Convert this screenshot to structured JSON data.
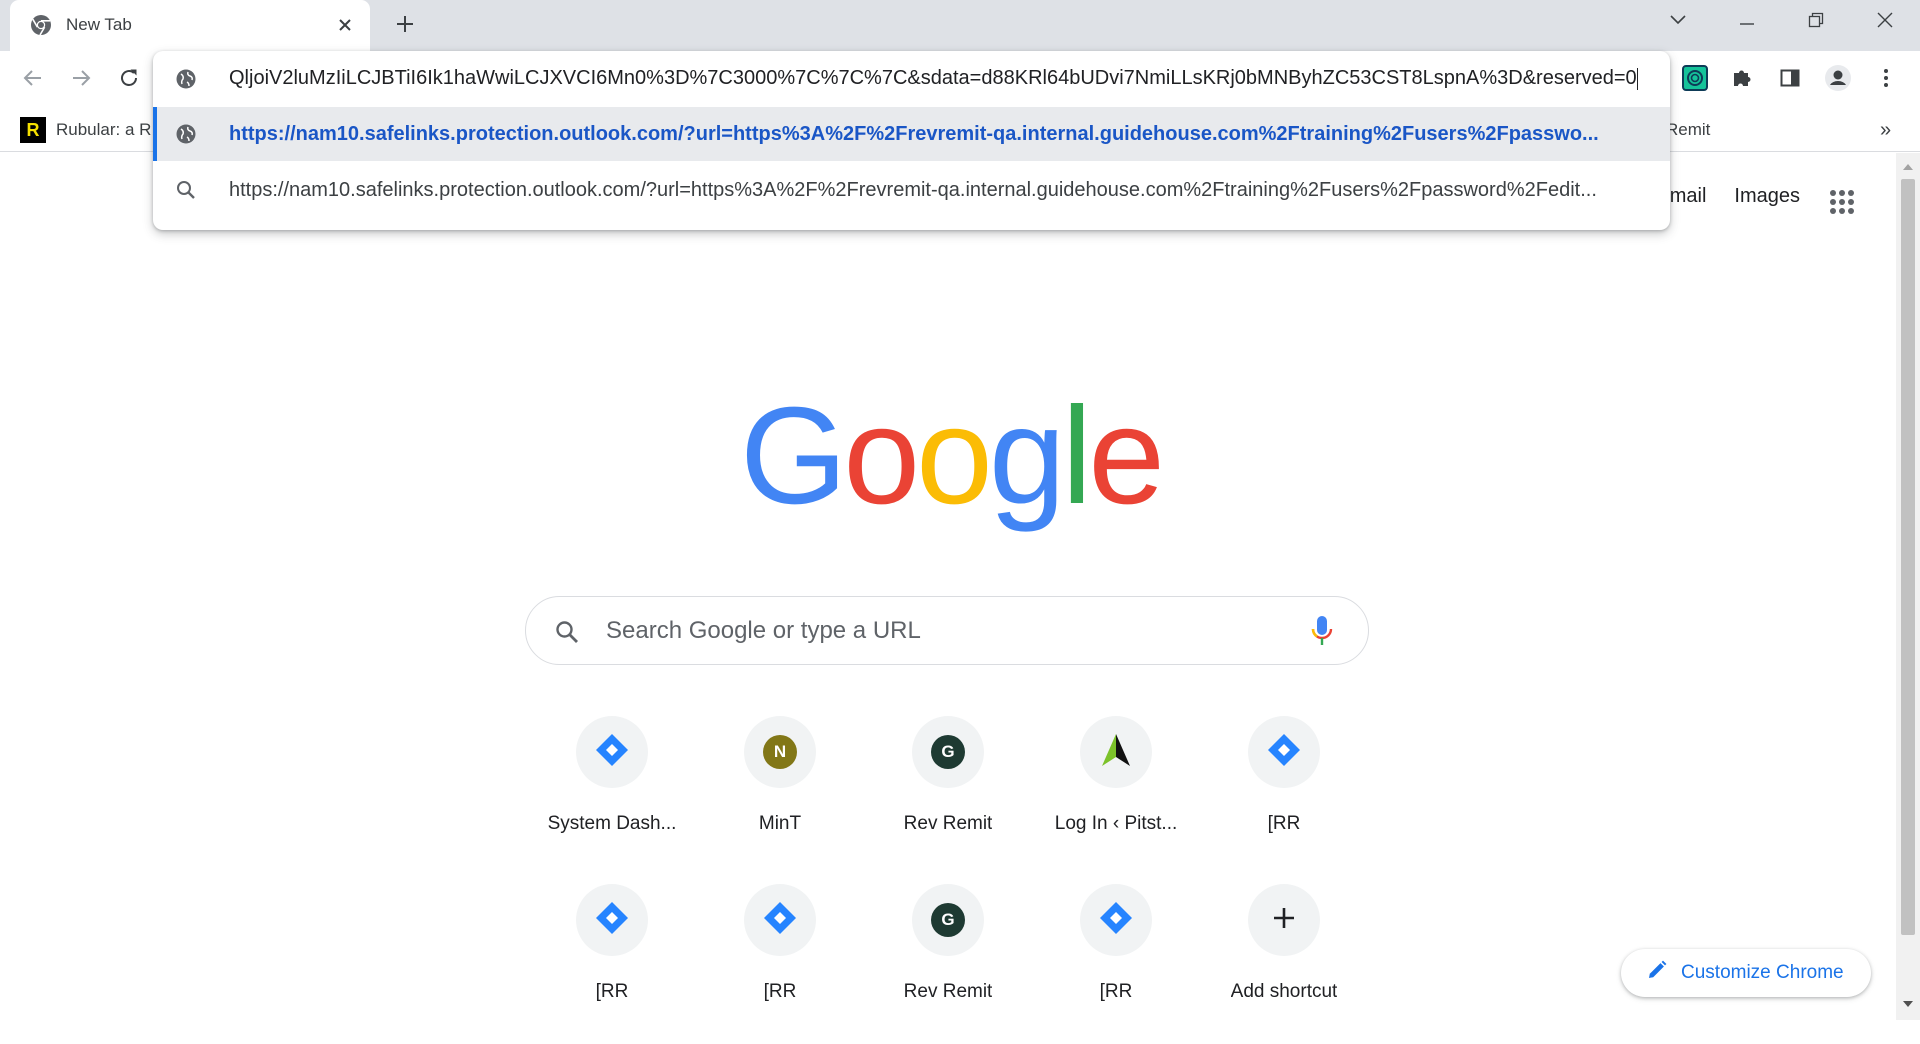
{
  "tab": {
    "title": "New Tab",
    "favicon": "chrome-icon",
    "close_icon": "close-icon"
  },
  "new_tab_icon": "plus-icon",
  "window_controls": [
    "chevron-down-icon",
    "minimize-icon",
    "restore-icon",
    "close-icon"
  ],
  "toolbar": {
    "back_icon": "arrow-left-icon",
    "forward_icon": "arrow-right-icon",
    "reload_icon": "reload-icon",
    "extensions": [
      "grammarly-icon",
      "puzzle-icon",
      "side-panel-icon",
      "profile-icon",
      "kebab-menu-icon"
    ]
  },
  "bookmarks": {
    "items": [
      {
        "label": "Rubular: a R",
        "icon": "rubular-icon"
      },
      {
        "label": "Remit"
      }
    ],
    "overflow": "»"
  },
  "omnibox": {
    "input_text": "QljoiV2luMzIiLCJBTiI6Ik1haWwiLCJXVCI6Mn0%3D%7C3000%7C%7C%7C&sdata=d88KRl64bUDvi7NmiLLsKRj0bMNByhZC53CST8LspnA%3D&reserved=0",
    "input_icon": "globe-icon",
    "suggestions": [
      {
        "text": "https://nam10.safelinks.protection.outlook.com/?url=https%3A%2F%2Frevremit-qa.internal.guidehouse.com%2Ftraining%2Fusers%2Fpasswo...",
        "icon": "globe-icon",
        "selected": true
      },
      {
        "text": "https://nam10.safelinks.protection.outlook.com/?url=https%3A%2F%2Frevremit-qa.internal.guidehouse.com%2Ftraining%2Fusers%2Fpassword%2Fedit...",
        "icon": "search-icon",
        "selected": false
      }
    ]
  },
  "ntp": {
    "gmail_label": "mail",
    "images_label": "Images",
    "apps_icon": "apps-grid-icon",
    "logo_text": "Google",
    "search_placeholder": "Search Google or type a URL",
    "search_icon": "search-icon",
    "mic_icon": "microphone-icon",
    "shortcuts": [
      {
        "label": "System Dash...",
        "icon": "jira-diamond-icon"
      },
      {
        "label": "MinT",
        "letter": "N",
        "color": "#827717"
      },
      {
        "label": "Rev Remit",
        "letter": "G",
        "color": "#1e3a32"
      },
      {
        "label": "Log In ‹ Pitst...",
        "icon": "pitstop-arrow-icon"
      },
      {
        "label": "[RR",
        "icon": "jira-diamond-icon"
      },
      {
        "label": "[RR",
        "icon": "jira-diamond-icon"
      },
      {
        "label": "[RR",
        "icon": "jira-diamond-icon"
      },
      {
        "label": "Rev Remit",
        "letter": "G",
        "color": "#1e3a32"
      },
      {
        "label": "[RR",
        "icon": "jira-diamond-icon"
      },
      {
        "label": "Add shortcut",
        "icon": "plus-icon"
      }
    ],
    "customize_label": "Customize Chrome",
    "customize_icon": "pencil-icon"
  },
  "colors": {
    "tabstrip": "#dee1e6",
    "accent": "#1a73e8",
    "selected_suggestion_text": "#1a56c6",
    "google_blue": "#4285f4",
    "google_red": "#ea4335",
    "google_yellow": "#fbbc05",
    "google_green": "#34a853"
  }
}
